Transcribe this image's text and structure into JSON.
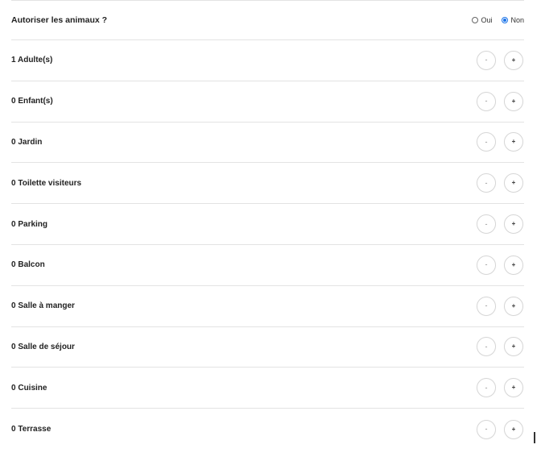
{
  "pets": {
    "label": "Autoriser les animaux ?",
    "options": [
      {
        "label": "Oui",
        "checked": false
      },
      {
        "label": "Non",
        "checked": true
      }
    ]
  },
  "counters": [
    {
      "count": "1",
      "label": "Adulte(s)"
    },
    {
      "count": "0",
      "label": "Enfant(s)"
    },
    {
      "count": "0",
      "label": "Jardin"
    },
    {
      "count": "0",
      "label": "Toilette visiteurs"
    },
    {
      "count": "0",
      "label": "Parking"
    },
    {
      "count": "0",
      "label": "Balcon"
    },
    {
      "count": "0",
      "label": "Salle à manger"
    },
    {
      "count": "0",
      "label": "Salle de séjour"
    },
    {
      "count": "0",
      "label": "Cuisine"
    },
    {
      "count": "0",
      "label": "Terrasse"
    }
  ],
  "controls": {
    "minus_label": "-",
    "plus_label": "+"
  },
  "colors": {
    "accent": "#1a73e8",
    "divider": "#e3e3e3"
  }
}
